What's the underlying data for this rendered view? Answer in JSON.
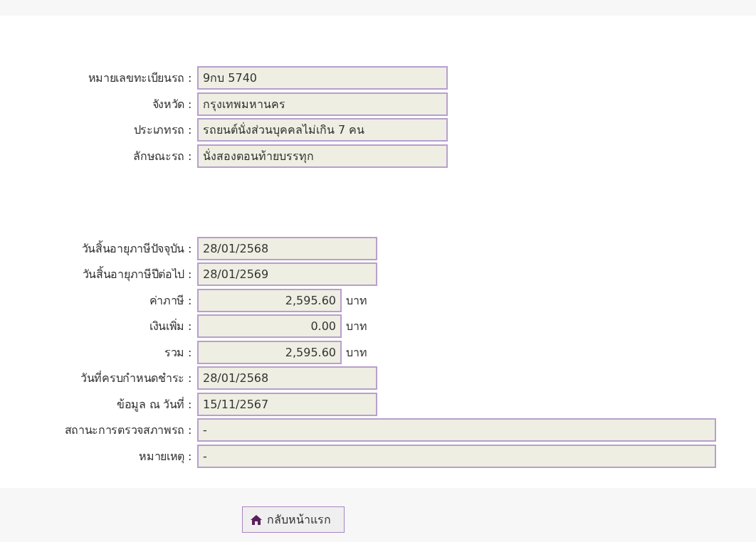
{
  "vehicle_section": [
    {
      "label": "หมายเลขทะเบียนรถ :",
      "value": "9กบ 5740",
      "kind": "wide"
    },
    {
      "label": "จังหวัด :",
      "value": "กรุงเทพมหานคร",
      "kind": "wide"
    },
    {
      "label": "ประเภทรถ :",
      "value": "รถยนต์นั่งส่วนบุคคลไม่เกิน 7 คน",
      "kind": "wide"
    },
    {
      "label": "ลักษณะรถ :",
      "value": "นั่งสองตอนท้ายบรรทุก",
      "kind": "wide"
    }
  ],
  "tax_section": [
    {
      "label": "วันสิ้นอายุภาษีปัจจุบัน :",
      "value": "28/01/2568",
      "kind": "medium"
    },
    {
      "label": "วันสิ้นอายุภาษีปีต่อไป :",
      "value": "28/01/2569",
      "kind": "medium"
    },
    {
      "label": "ค่าภาษี :",
      "value": "2,595.60",
      "kind": "amount",
      "unit": "บาท"
    },
    {
      "label": "เงินเพิ่ม :",
      "value": "0.00",
      "kind": "amount",
      "unit": "บาท"
    },
    {
      "label": "รวม :",
      "value": "2,595.60",
      "kind": "amount",
      "unit": "บาท"
    },
    {
      "label": "วันที่ครบกำหนดชำระ :",
      "value": "28/01/2568",
      "kind": "medium"
    },
    {
      "label": "ข้อมูล ณ วันที่ :",
      "value": "15/11/2567",
      "kind": "medium"
    },
    {
      "label": "สถานะการตรวจสภาพรถ :",
      "value": "-",
      "kind": "full"
    },
    {
      "label": "หมายเหตุ :",
      "value": "-",
      "kind": "full"
    }
  ],
  "home_button": {
    "label": "กลับหน้าแรก"
  }
}
